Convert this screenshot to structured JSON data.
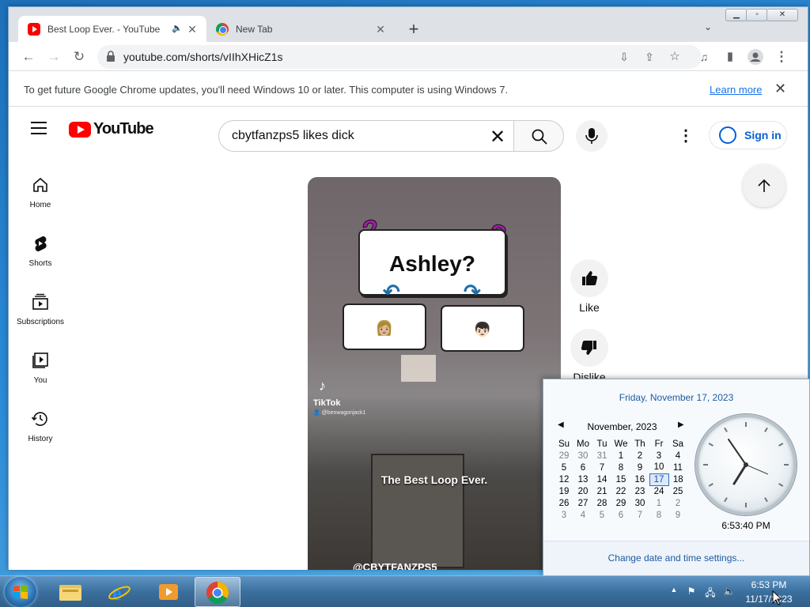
{
  "browser": {
    "tabs": [
      {
        "title": "Best Loop Ever. - YouTube",
        "icon": "youtube-icon",
        "active": true
      },
      {
        "title": "New Tab",
        "icon": "chrome-icon",
        "active": false
      }
    ],
    "new_tab_symbol": "+",
    "url": "youtube.com/shorts/vIIhXHicZ1s",
    "infobar": {
      "message": "To get future Google Chrome updates, you'll need Windows 10 or later. This computer is using Windows 7.",
      "link": "Learn more",
      "close_symbol": "✕"
    }
  },
  "youtube": {
    "logo_text": "YouTube",
    "search_query": "cbytfanzps5 likes dick",
    "sign_in_label": "Sign in",
    "nav": [
      {
        "label": "Home",
        "icon": "home-icon"
      },
      {
        "label": "Shorts",
        "icon": "shorts-icon"
      },
      {
        "label": "Subscriptions",
        "icon": "subscriptions-icon"
      },
      {
        "label": "You",
        "icon": "library-icon"
      },
      {
        "label": "History",
        "icon": "history-icon"
      }
    ],
    "video": {
      "card_title": "Ashley?",
      "option_left": "👩🏼",
      "option_right": "👦🏻",
      "tiktok_label": "TikTok",
      "tiktok_user": "👤 @benwagonjack1",
      "overlay_text": "The Best Loop Ever.",
      "channel": "@CBYTFANZPS5"
    },
    "actions": {
      "like_label": "Like",
      "dislike_label": "Dislike"
    }
  },
  "calendar_popup": {
    "long_date": "Friday, November 17, 2023",
    "month_label": "November, 2023",
    "weekdays": [
      "Su",
      "Mo",
      "Tu",
      "We",
      "Th",
      "Fr",
      "Sa"
    ],
    "weeks": [
      [
        "29",
        "30",
        "31",
        "1",
        "2",
        "3",
        "4"
      ],
      [
        "5",
        "6",
        "7",
        "8",
        "9",
        "10",
        "11"
      ],
      [
        "12",
        "13",
        "14",
        "15",
        "16",
        "17",
        "18"
      ],
      [
        "19",
        "20",
        "21",
        "22",
        "23",
        "24",
        "25"
      ],
      [
        "26",
        "27",
        "28",
        "29",
        "30",
        "1",
        "2"
      ],
      [
        "3",
        "4",
        "5",
        "6",
        "7",
        "8",
        "9"
      ]
    ],
    "today": "17",
    "clock_time": "6:53:40 PM",
    "settings_link": "Change date and time settings..."
  },
  "taskbar": {
    "apps": [
      "windows-explorer-icon",
      "internet-explorer-icon",
      "media-player-icon",
      "chrome-icon"
    ],
    "active_app": "chrome-icon",
    "time": "6:53 PM",
    "date": "11/17/2023"
  },
  "colors": {
    "youtube_red": "#ff0000",
    "link_blue": "#065fd4",
    "chrome_link": "#1a73e8",
    "win7_link": "#1e5aa0"
  }
}
